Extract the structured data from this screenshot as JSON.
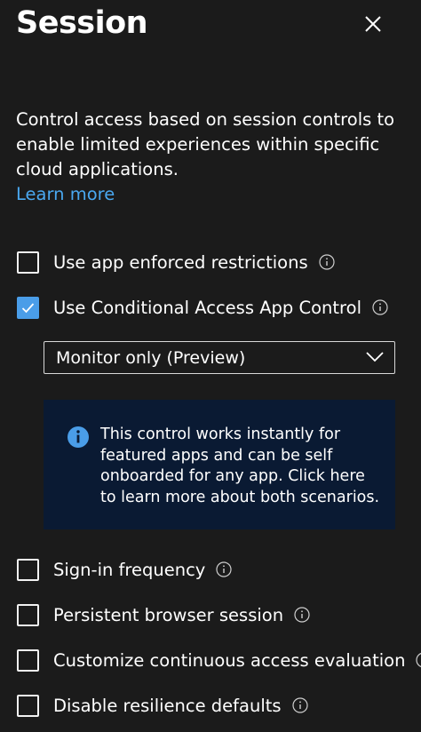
{
  "panel": {
    "title": "Session",
    "close_icon": "close-icon"
  },
  "description": {
    "text": "Control access based on session controls to enable limited experiences within specific cloud applications.",
    "learn_more": "Learn more"
  },
  "options": [
    {
      "label": "Use app enforced restrictions",
      "checked": false
    },
    {
      "label": "Use Conditional Access App Control",
      "checked": true
    },
    {
      "label": "Sign-in frequency",
      "checked": false
    },
    {
      "label": "Persistent browser session",
      "checked": false
    },
    {
      "label": "Customize continuous access evaluation",
      "checked": false
    },
    {
      "label": "Disable resilience defaults",
      "checked": false
    }
  ],
  "app_control": {
    "selected": "Monitor only (Preview)",
    "info_text": "This control works instantly for featured apps and can be self onboarded for any app. Click here to learn more about both scenarios."
  },
  "colors": {
    "background": "#1b1b1b",
    "accent": "#4a9de8",
    "link": "#4aa8f0",
    "info_box": "#0a1a33"
  }
}
